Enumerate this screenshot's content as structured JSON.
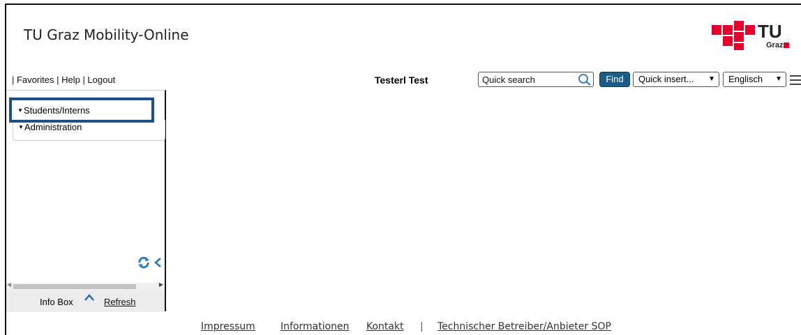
{
  "header": {
    "app_title": "TU Graz Mobility-Online",
    "logo_text": "TU",
    "logo_subtext": "Graz"
  },
  "topbar": {
    "links": [
      "| Favorites",
      "| Help",
      "| Logout"
    ],
    "username": "Testerl Test",
    "search_placeholder": "Quick search",
    "find_label": "Find",
    "quick_insert_label": "Quick insert...",
    "language_label": "Englisch"
  },
  "sidebar": {
    "items": [
      {
        "label": "Students/Interns",
        "icon": "triangle-down-icon"
      },
      {
        "label": "Administration",
        "icon": "triangle-down-icon"
      }
    ],
    "infobox_label": "Info Box",
    "refresh_label": "Refresh"
  },
  "footer": {
    "links": [
      "Impressum",
      "Informationen",
      "Kontakt"
    ],
    "separator": "|",
    "operator_link": "Technischer Betreiber/Anbieter SOP"
  },
  "colors": {
    "accent": "#1e5c87",
    "highlight_border": "#1e4e8c",
    "logo_red": "#e4002b",
    "refresh_blue": "#2a7ac9"
  }
}
